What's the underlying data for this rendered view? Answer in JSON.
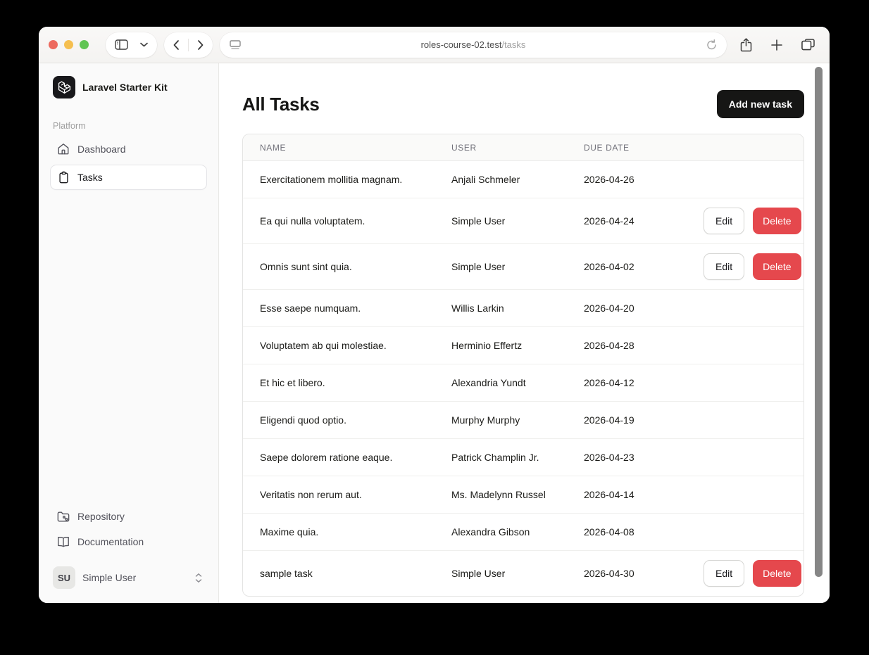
{
  "browser": {
    "url_host": "roles-course-02.test",
    "url_path": "/tasks"
  },
  "sidebar": {
    "app_name": "Laravel Starter Kit",
    "section_label": "Platform",
    "items": [
      {
        "label": "Dashboard",
        "active": false
      },
      {
        "label": "Tasks",
        "active": true
      }
    ],
    "footer_items": [
      {
        "label": "Repository"
      },
      {
        "label": "Documentation"
      }
    ],
    "user": {
      "initials": "SU",
      "name": "Simple User"
    }
  },
  "main": {
    "title": "All Tasks",
    "add_button_label": "Add new task",
    "table": {
      "headers": [
        "Name",
        "User",
        "Due date"
      ],
      "edit_label": "Edit",
      "delete_label": "Delete",
      "rows": [
        {
          "name": "Exercitationem mollitia magnam.",
          "user": "Anjali Schmeler",
          "due_date": "2026-04-26",
          "actions": false
        },
        {
          "name": "Ea qui nulla voluptatem.",
          "user": "Simple User",
          "due_date": "2026-04-24",
          "actions": true
        },
        {
          "name": "Omnis sunt sint quia.",
          "user": "Simple User",
          "due_date": "2026-04-02",
          "actions": true
        },
        {
          "name": "Esse saepe numquam.",
          "user": "Willis Larkin",
          "due_date": "2026-04-20",
          "actions": false
        },
        {
          "name": "Voluptatem ab qui molestiae.",
          "user": "Herminio Effertz",
          "due_date": "2026-04-28",
          "actions": false
        },
        {
          "name": "Et hic et libero.",
          "user": "Alexandria Yundt",
          "due_date": "2026-04-12",
          "actions": false
        },
        {
          "name": "Eligendi quod optio.",
          "user": "Murphy Murphy",
          "due_date": "2026-04-19",
          "actions": false
        },
        {
          "name": "Saepe dolorem ratione eaque.",
          "user": "Patrick Champlin Jr.",
          "due_date": "2026-04-23",
          "actions": false
        },
        {
          "name": "Veritatis non rerum aut.",
          "user": "Ms. Madelynn Russel",
          "due_date": "2026-04-14",
          "actions": false
        },
        {
          "name": "Maxime quia.",
          "user": "Alexandra Gibson",
          "due_date": "2026-04-08",
          "actions": false
        },
        {
          "name": "sample task",
          "user": "Simple User",
          "due_date": "2026-04-30",
          "actions": true
        }
      ]
    }
  },
  "colors": {
    "accent_dark": "#161615",
    "destructive_red": "#e5484d",
    "sidebar_bg": "#fafafa",
    "traffic_red": "#ed6a5e",
    "traffic_yellow": "#f5bf4f",
    "traffic_green": "#61c554"
  }
}
